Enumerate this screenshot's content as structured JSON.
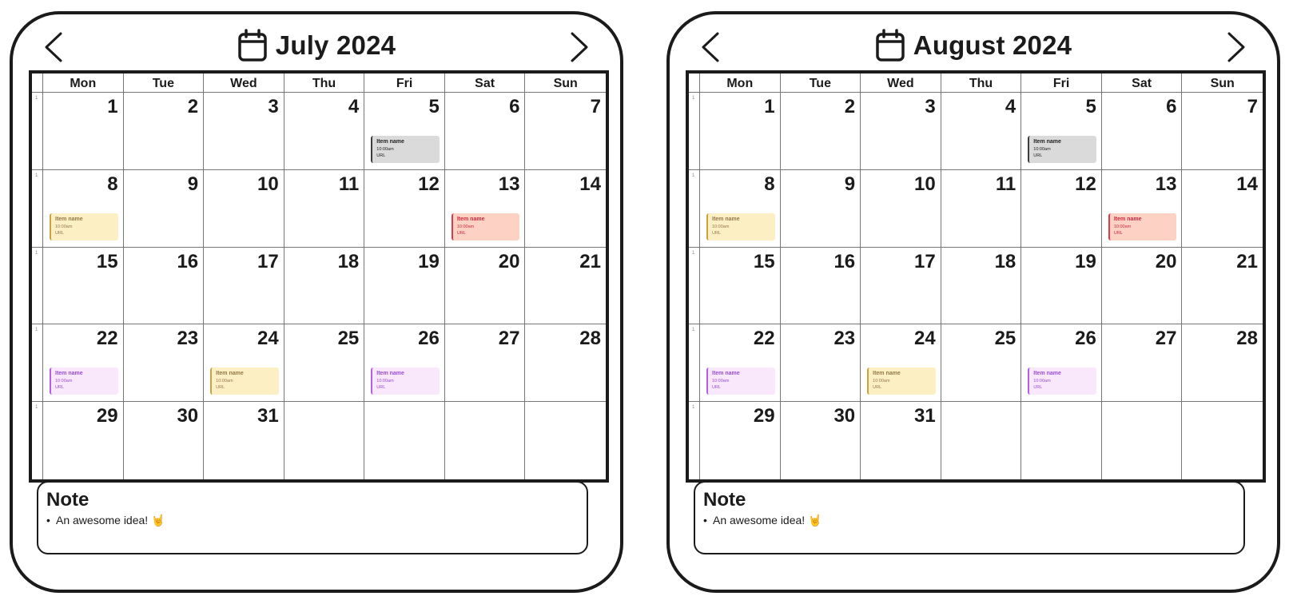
{
  "weekdays": [
    "Mon",
    "Tue",
    "Wed",
    "Thu",
    "Fri",
    "Sat",
    "Sun"
  ],
  "week_marker": "1",
  "calendars": [
    {
      "title": "July 2024",
      "weeks": [
        [
          "1",
          "2",
          "3",
          "4",
          "5",
          "6",
          "7"
        ],
        [
          "8",
          "9",
          "10",
          "11",
          "12",
          "13",
          "14"
        ],
        [
          "15",
          "16",
          "17",
          "18",
          "19",
          "20",
          "21"
        ],
        [
          "22",
          "23",
          "24",
          "25",
          "26",
          "27",
          "28"
        ],
        [
          "29",
          "30",
          "31",
          "",
          "",
          "",
          ""
        ]
      ],
      "events": [
        {
          "week": 0,
          "day": 4,
          "name": "Item name",
          "time": "10:00am",
          "url": "URL",
          "color": "gray"
        },
        {
          "week": 1,
          "day": 0,
          "name": "Item name",
          "time": "10:00am",
          "url": "URL",
          "color": "yellow"
        },
        {
          "week": 1,
          "day": 5,
          "name": "Item name",
          "time": "10:00am",
          "url": "URL",
          "color": "red"
        },
        {
          "week": 3,
          "day": 0,
          "name": "Item name",
          "time": "10:00am",
          "url": "URL",
          "color": "purple"
        },
        {
          "week": 3,
          "day": 2,
          "name": "Item name",
          "time": "10:00am",
          "url": "URL",
          "color": "yellow"
        },
        {
          "week": 3,
          "day": 4,
          "name": "Item name",
          "time": "10:00am",
          "url": "URL",
          "color": "purple"
        }
      ],
      "note": {
        "title": "Note",
        "items": [
          "An awesome idea! 🤘"
        ]
      }
    },
    {
      "title": "August 2024",
      "weeks": [
        [
          "1",
          "2",
          "3",
          "4",
          "5",
          "6",
          "7"
        ],
        [
          "8",
          "9",
          "10",
          "11",
          "12",
          "13",
          "14"
        ],
        [
          "15",
          "16",
          "17",
          "18",
          "19",
          "20",
          "21"
        ],
        [
          "22",
          "23",
          "24",
          "25",
          "26",
          "27",
          "28"
        ],
        [
          "29",
          "30",
          "31",
          "",
          "",
          "",
          ""
        ]
      ],
      "events": [
        {
          "week": 0,
          "day": 4,
          "name": "Item name",
          "time": "10:00am",
          "url": "URL",
          "color": "gray"
        },
        {
          "week": 1,
          "day": 0,
          "name": "Item name",
          "time": "10:00am",
          "url": "URL",
          "color": "yellow"
        },
        {
          "week": 1,
          "day": 5,
          "name": "Item name",
          "time": "10:00am",
          "url": "URL",
          "color": "red"
        },
        {
          "week": 3,
          "day": 0,
          "name": "Item name",
          "time": "10:00am",
          "url": "URL",
          "color": "purple"
        },
        {
          "week": 3,
          "day": 2,
          "name": "Item name",
          "time": "10:00am",
          "url": "URL",
          "color": "yellow"
        },
        {
          "week": 3,
          "day": 4,
          "name": "Item name",
          "time": "10:00am",
          "url": "URL",
          "color": "purple"
        }
      ],
      "note": {
        "title": "Note",
        "items": [
          "An awesome idea! 🤘"
        ]
      }
    }
  ],
  "icons": {
    "prev": "chevron-left-icon",
    "next": "chevron-right-icon",
    "title": "calendar-icon"
  },
  "colors": {
    "gray": "#dadada",
    "yellow": "#fcefc3",
    "red": "#fdd2c4",
    "purple": "#f9e8fc",
    "border": "#1b1b1b"
  }
}
